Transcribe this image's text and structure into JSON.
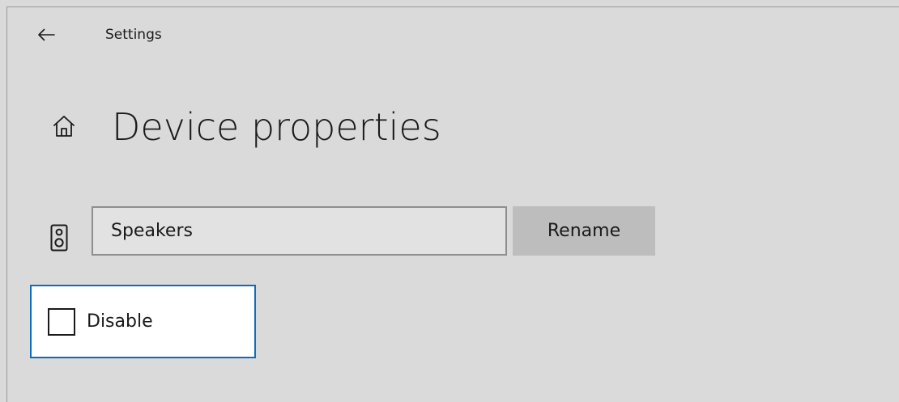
{
  "header": {
    "title": "Settings",
    "back_icon": "arrow-left-icon"
  },
  "page": {
    "title": "Device properties",
    "home_icon": "home-icon"
  },
  "device": {
    "icon": "speaker-icon",
    "name_value": "Speakers",
    "rename_label": "Rename"
  },
  "disable": {
    "label": "Disable",
    "checked": false
  },
  "colors": {
    "background": "#dadada",
    "focus_border": "#0f6cbd",
    "button_bg": "#bdbdbd",
    "input_border": "#8e8e8e"
  }
}
